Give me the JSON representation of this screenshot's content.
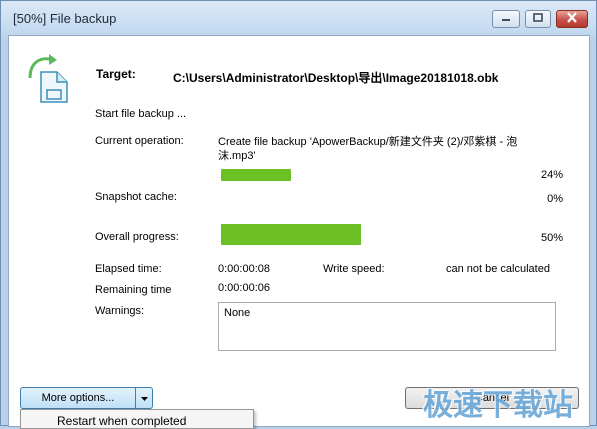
{
  "window": {
    "title": "[50%] File backup"
  },
  "icons": {
    "app": "backup-file-icon",
    "minimize": "minimize-icon",
    "maximize": "maximize-icon",
    "close": "close-icon",
    "dropdown": "chevron-down-icon"
  },
  "colors": {
    "progress_fill": "#6cc024",
    "titlebar_close": "#c75050",
    "watermark": "#6aa7d8"
  },
  "target": {
    "label": "Target:",
    "path": "C:\\Users\\Administrator\\Desktop\\导出\\Image20181018.obk"
  },
  "status": {
    "start_text": "Start file backup ..."
  },
  "current_operation": {
    "label": "Current operation:",
    "text": "Create file backup  'ApowerBackup/新建文件夹 (2)/邓紫棋 - 泡沫.mp3'",
    "progress": 0.24,
    "percent_text": "24%"
  },
  "snapshot_cache": {
    "label": "Snapshot cache:",
    "progress": 0,
    "percent_text": "0%"
  },
  "overall_progress": {
    "label": "Overall progress:",
    "progress": 0.5,
    "percent_text": "50%"
  },
  "timing": {
    "elapsed_label": "Elapsed time:",
    "elapsed_value": "0:00:00:08",
    "speed_label": "Write speed:",
    "speed_value": "can not be calculated",
    "remaining_label": "Remaining time",
    "remaining_value": "0:00:00:06"
  },
  "warnings": {
    "label": "Warnings:",
    "value": "None"
  },
  "buttons": {
    "more_options": "More options...",
    "cancel": "Cancel"
  },
  "dropdown_menu": {
    "items": [
      "Restart when completed"
    ]
  },
  "watermark": {
    "text": "极速下载站"
  }
}
